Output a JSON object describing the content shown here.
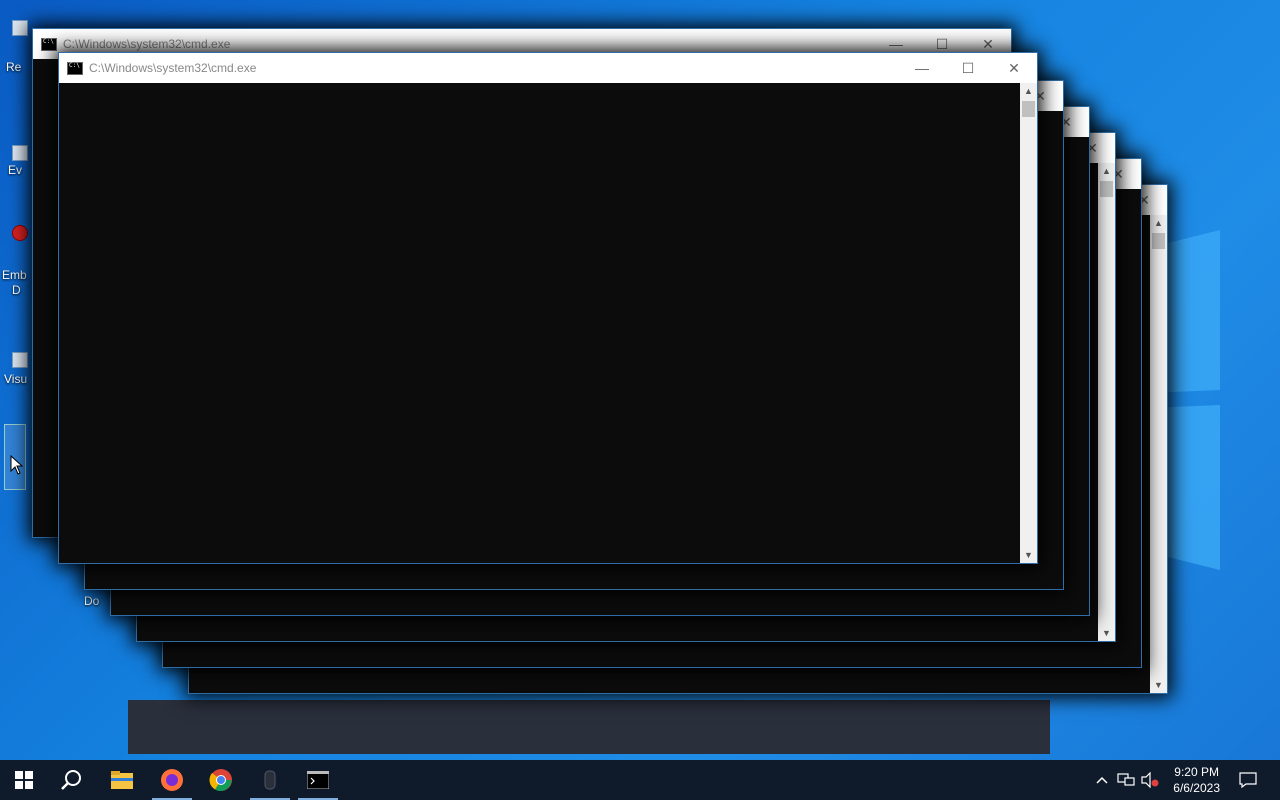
{
  "window": {
    "title": "C:\\Windows\\system32\\cmd.exe"
  },
  "controls": {
    "minimize": "—",
    "maximize": "☐",
    "close": "✕",
    "scroll_up": "▲",
    "scroll_down": "▼"
  },
  "desktop_icons": [
    {
      "label": "Re"
    },
    {
      "label": "Ev"
    },
    {
      "label": "Emb"
    },
    {
      "label": "D"
    },
    {
      "label": "Visu"
    },
    {
      "label": "Do"
    }
  ],
  "taskbar": {
    "items": [
      {
        "name": "start-button",
        "icon": "windows-icon"
      },
      {
        "name": "search-button",
        "icon": "search-icon"
      },
      {
        "name": "file-explorer",
        "icon": "folder-icon"
      },
      {
        "name": "firefox",
        "icon": "firefox-icon"
      },
      {
        "name": "chrome",
        "icon": "chrome-icon"
      },
      {
        "name": "unknown-app",
        "icon": "app-icon"
      },
      {
        "name": "cmd",
        "icon": "terminal-icon"
      }
    ],
    "clock": {
      "time": "9:20 PM",
      "date": "6/6/2023"
    }
  },
  "colors": {
    "taskbar": "#0f1a2a",
    "accent": "#7fb0e0",
    "console": "#0c0c0c"
  }
}
